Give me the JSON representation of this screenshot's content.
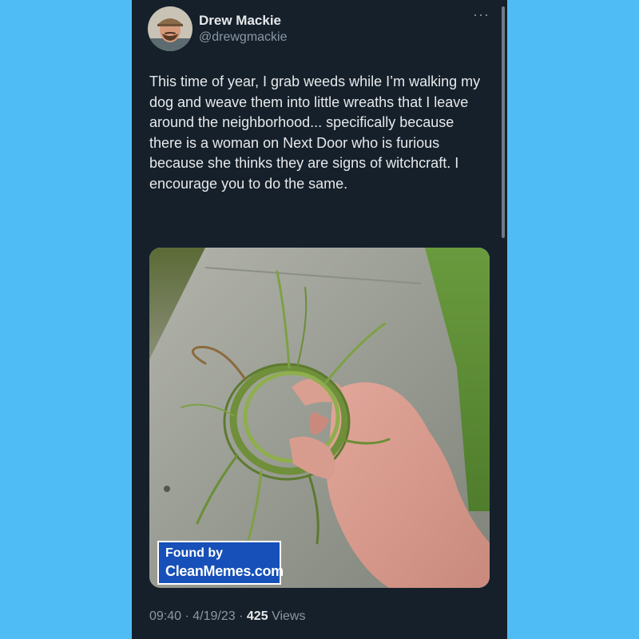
{
  "tweet": {
    "display_name": "Drew Mackie",
    "handle": "@drewgmackie",
    "more_icon": "more-horizontal-icon",
    "text": "This time of year, I grab weeds while I’m walking my dog and weave them into little wreaths that I leave around the neighborhood... specifically because there is a woman on Next Door who is furious because she thinks they are signs of witchcraft. I encourage you to do the same.",
    "time": "09:40",
    "date": "4/19/23",
    "separator": "·",
    "views_count": "425",
    "views_label": "Views"
  },
  "watermark": {
    "line1": "Found by",
    "line2": "CleanMemes.com"
  },
  "colors": {
    "page_background": "#4fbcf6",
    "card_background": "#15202b",
    "primary_text": "#e7e9ea",
    "secondary_text": "#8b98a5",
    "watermark_background": "#1650b8"
  }
}
